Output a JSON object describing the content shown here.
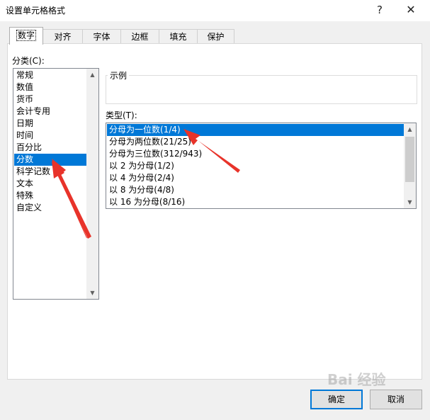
{
  "dialog": {
    "title": "设置单元格格式",
    "help_glyph": "?",
    "close_glyph": "✕"
  },
  "tabs": [
    {
      "label": "数字",
      "active": true
    },
    {
      "label": "对齐"
    },
    {
      "label": "字体"
    },
    {
      "label": "边框"
    },
    {
      "label": "填充"
    },
    {
      "label": "保护"
    }
  ],
  "category": {
    "label": "分类(C):",
    "items": [
      "常规",
      "数值",
      "货币",
      "会计专用",
      "日期",
      "时间",
      "百分比",
      "分数",
      "科学记数",
      "文本",
      "特殊",
      "自定义"
    ],
    "selected": "分数"
  },
  "sample": {
    "label": "示例",
    "value": ""
  },
  "type": {
    "label": "类型(T):",
    "items": [
      "分母为一位数(1/4)",
      "分母为两位数(21/25)",
      "分母为三位数(312/943)",
      "以 2 为分母(1/2)",
      "以 4 为分母(2/4)",
      "以 8 为分母(4/8)",
      "以 16 为分母(8/16)"
    ],
    "selected": "分母为一位数(1/4)"
  },
  "buttons": {
    "ok": "确定",
    "cancel": "取消"
  },
  "watermark": "Bai 经验",
  "colors": {
    "selection": "#0078d7",
    "annotation_arrow": "#e8332a"
  }
}
